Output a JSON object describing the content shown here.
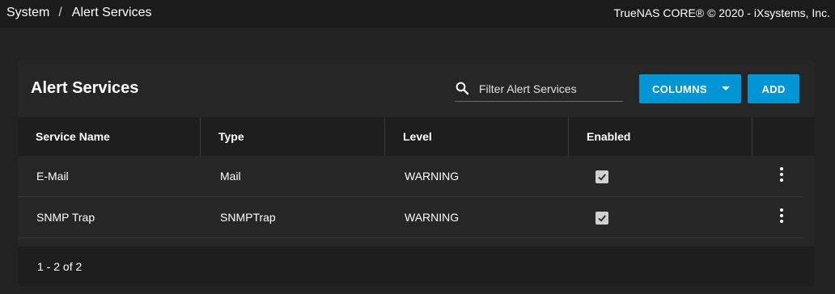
{
  "breadcrumb": {
    "items": [
      "System",
      "Alert Services"
    ],
    "separator": "/"
  },
  "copyright": "TrueNAS CORE® © 2020 - iXsystems, Inc.",
  "card": {
    "title": "Alert Services",
    "filter": {
      "placeholder": "Filter Alert Services",
      "value": ""
    },
    "columns_button": "COLUMNS",
    "add_button": "ADD"
  },
  "table": {
    "headers": [
      "Service Name",
      "Type",
      "Level",
      "Enabled"
    ],
    "rows": [
      {
        "service_name": "E-Mail",
        "type": "Mail",
        "level": "WARNING",
        "enabled": true
      },
      {
        "service_name": "SNMP Trap",
        "type": "SNMPTrap",
        "level": "WARNING",
        "enabled": true
      }
    ],
    "pagination": "1 - 2 of 2"
  },
  "colors": {
    "accent": "#0095d5",
    "background": "#222222",
    "card": "#262626"
  },
  "icons": {
    "search": "search-icon",
    "menu": "more-vert-icon",
    "check": "check-icon",
    "caret": "caret-down-icon"
  }
}
